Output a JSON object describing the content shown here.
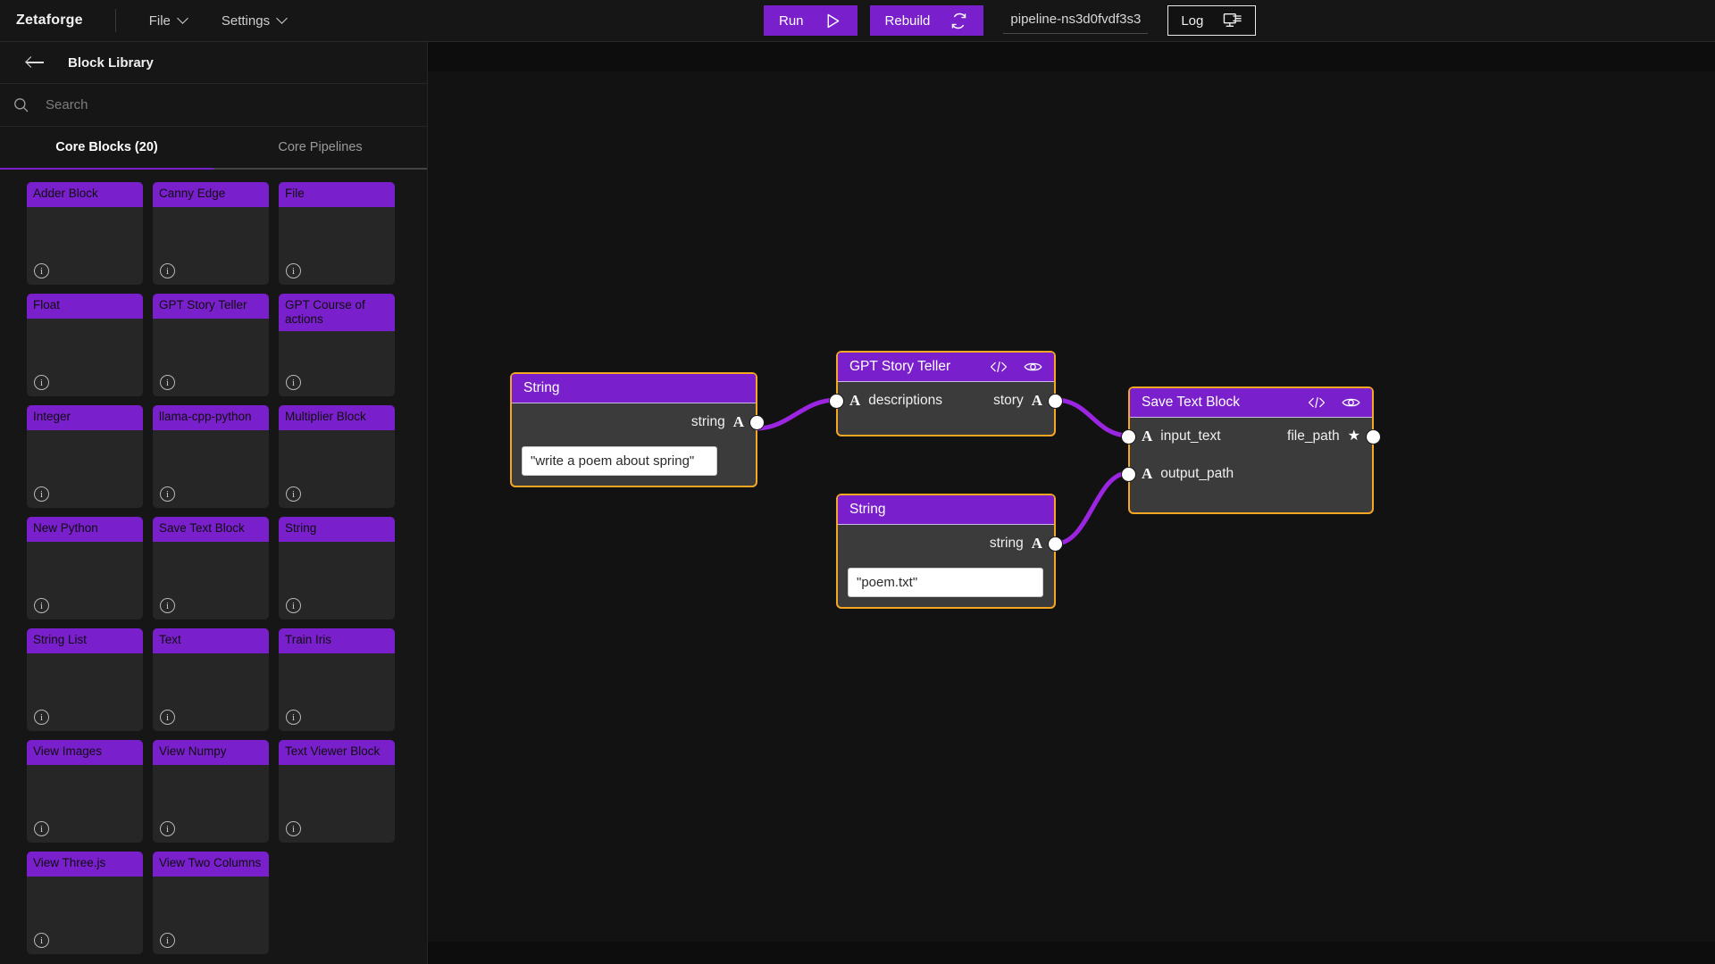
{
  "topbar": {
    "brand": "Zetaforge",
    "menus": [
      {
        "label": "File",
        "icon": "chevron-down-icon"
      },
      {
        "label": "Settings",
        "icon": "chevron-down-icon"
      }
    ],
    "run_label": "Run",
    "run_icon": "play-icon",
    "rebuild_label": "Rebuild",
    "rebuild_icon": "refresh-icon",
    "pipeline_name": "pipeline-ns3d0fvdf3s3",
    "log_label": "Log",
    "log_icon": "monitor-terminal-icon",
    "accent": "#7a1fcc"
  },
  "sidebar": {
    "back_icon": "back-arrow-icon",
    "title": "Block Library",
    "search": {
      "placeholder": "Search",
      "value": "",
      "icon": "search-icon"
    },
    "tabs": [
      {
        "label": "Core Blocks (20)",
        "active": true
      },
      {
        "label": "Core Pipelines",
        "active": false
      }
    ],
    "info_glyph": "i",
    "blocks": [
      {
        "name": "Adder Block"
      },
      {
        "name": "Canny Edge"
      },
      {
        "name": "File"
      },
      {
        "name": "Float"
      },
      {
        "name": "GPT Story Teller"
      },
      {
        "name": "GPT Course of actions"
      },
      {
        "name": "Integer"
      },
      {
        "name": "llama-cpp-python"
      },
      {
        "name": "Multiplier Block"
      },
      {
        "name": "New Python"
      },
      {
        "name": "Save Text Block"
      },
      {
        "name": "String"
      },
      {
        "name": "String List"
      },
      {
        "name": "Text"
      },
      {
        "name": "Train Iris"
      },
      {
        "name": "View Images"
      },
      {
        "name": "View Numpy"
      },
      {
        "name": "Text Viewer Block"
      },
      {
        "name": "View Three.js"
      },
      {
        "name": "View Two Columns"
      }
    ]
  },
  "canvas": {
    "edge_color": "#9b25e0",
    "node_border": "#f5a623",
    "nodes": [
      {
        "id": "string-prompt",
        "title": "String",
        "header_icons": [],
        "outputs": [
          {
            "label": "string",
            "type_glyph": "A"
          }
        ],
        "inputs": [],
        "field_value": "\"write a poem about spring\""
      },
      {
        "id": "gpt-story-teller",
        "title": "GPT Story Teller",
        "header_icons": [
          "code-icon",
          "eye-icon"
        ],
        "inputs": [
          {
            "label": "descriptions",
            "type_glyph": "A"
          }
        ],
        "outputs": [
          {
            "label": "story",
            "type_glyph": "A"
          }
        ]
      },
      {
        "id": "save-text-block",
        "title": "Save Text Block",
        "header_icons": [
          "code-icon",
          "eye-icon"
        ],
        "inputs": [
          {
            "label": "input_text",
            "type_glyph": "A"
          },
          {
            "label": "output_path",
            "type_glyph": "A"
          }
        ],
        "outputs": [
          {
            "label": "file_path",
            "type_glyph": "star-icon"
          }
        ]
      },
      {
        "id": "string-filename",
        "title": "String",
        "header_icons": [],
        "outputs": [
          {
            "label": "string",
            "type_glyph": "A"
          }
        ],
        "inputs": [],
        "field_value": "\"poem.txt\""
      }
    ]
  }
}
